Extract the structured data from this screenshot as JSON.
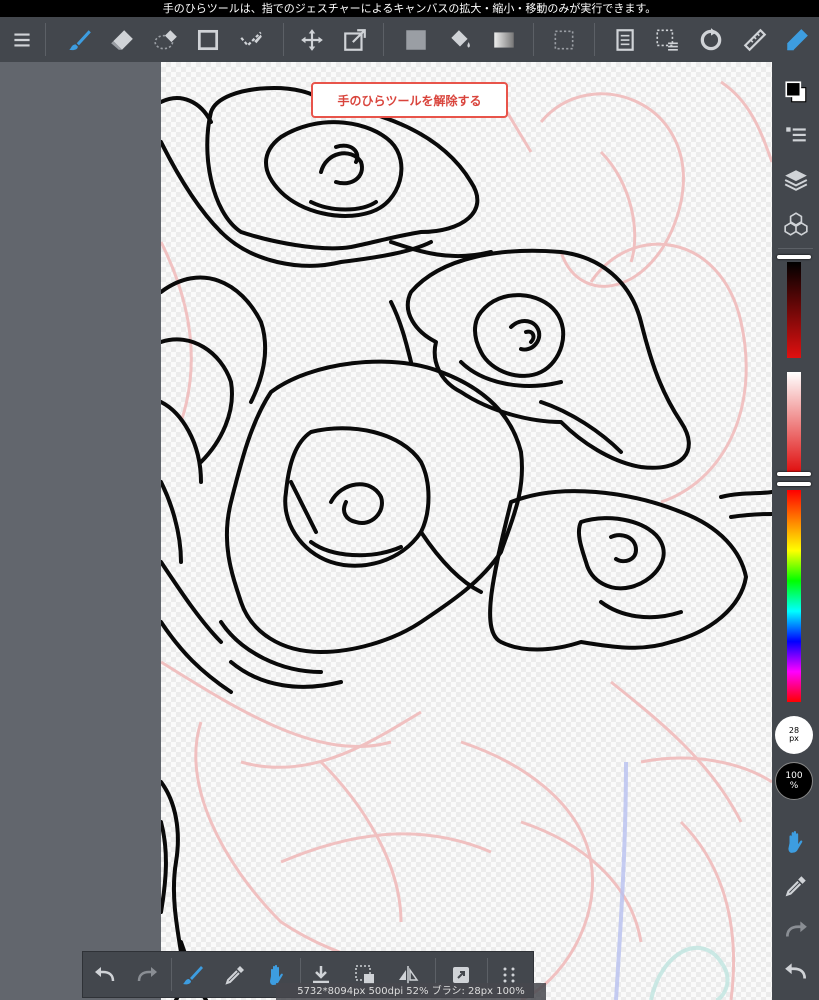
{
  "status_message": "手のひらツールは、指でのジェスチャーによるキャンバスの拡大・縮小・移動のみが実行できます。",
  "release_hand_tool_label": "手のひらツールを解除する",
  "brush_size": {
    "value": "28",
    "unit": "px"
  },
  "opacity": {
    "value": "100",
    "unit": "%"
  },
  "canvas_info": "5732*8094px 500dpi 52% ブラシ: 28px 100%",
  "colors": {
    "accent": "#3d9de0",
    "toolbar_bg": "#43474d",
    "release_button_border": "#e8544b"
  },
  "toolbar_icons": [
    "menu-icon",
    "brush-icon",
    "eraser-icon",
    "lasso-eraser-icon",
    "shape-icon",
    "select-pen-icon",
    "move-icon",
    "transform-icon",
    "fill-color-icon",
    "bucket-icon",
    "gradient-icon",
    "select-marquee-icon",
    "page-icon",
    "select-menu-icon",
    "rotate-icon",
    "ruler-icon",
    "pen-icon"
  ],
  "right_panel_icons": [
    "color-swap-icon",
    "layer-list-icon",
    "layers-icon",
    "materials-icon",
    "hand-icon",
    "eyedropper-icon",
    "redo-icon",
    "undo-icon"
  ],
  "bottom_bar_icons": [
    "undo-icon",
    "redo-icon",
    "brush-icon",
    "eyedropper-icon",
    "hand-icon",
    "save-icon",
    "snap-icon",
    "flip-icon",
    "fullscreen-icon",
    "grid-icon"
  ]
}
